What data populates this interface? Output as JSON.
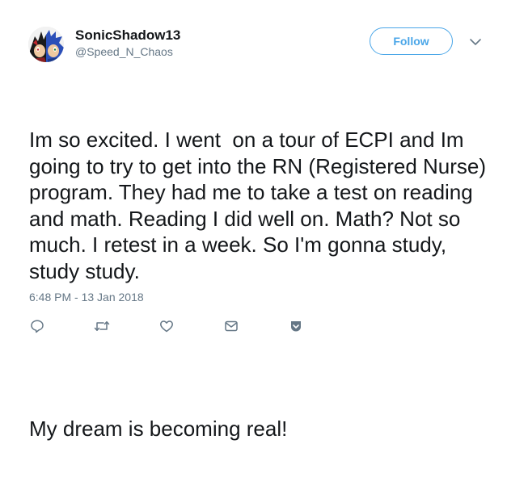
{
  "user": {
    "display_name": "SonicShadow13",
    "handle": "@Speed_N_Chaos"
  },
  "follow_button": {
    "label": "Follow"
  },
  "tweet": {
    "paragraphs": [
      "Im so excited. I went  on a tour of ECPI and Im going to try to get into the RN (Registered Nurse) program. They had me to take a test on reading and math. Reading I did well on. Math? Not so much. I retest in a week. So I'm gonna study, study study.",
      "My dream is becoming real!"
    ],
    "timestamp": "6:48 PM - 13 Jan 2018"
  },
  "actions": [
    {
      "icon": "reply-icon"
    },
    {
      "icon": "retweet-icon"
    },
    {
      "icon": "like-icon"
    },
    {
      "icon": "direct-message-icon"
    },
    {
      "icon": "save-icon"
    }
  ],
  "colors": {
    "accent": "#4aa6e8",
    "text": "#14171a",
    "muted": "#657786",
    "action_icon": "#657786"
  }
}
